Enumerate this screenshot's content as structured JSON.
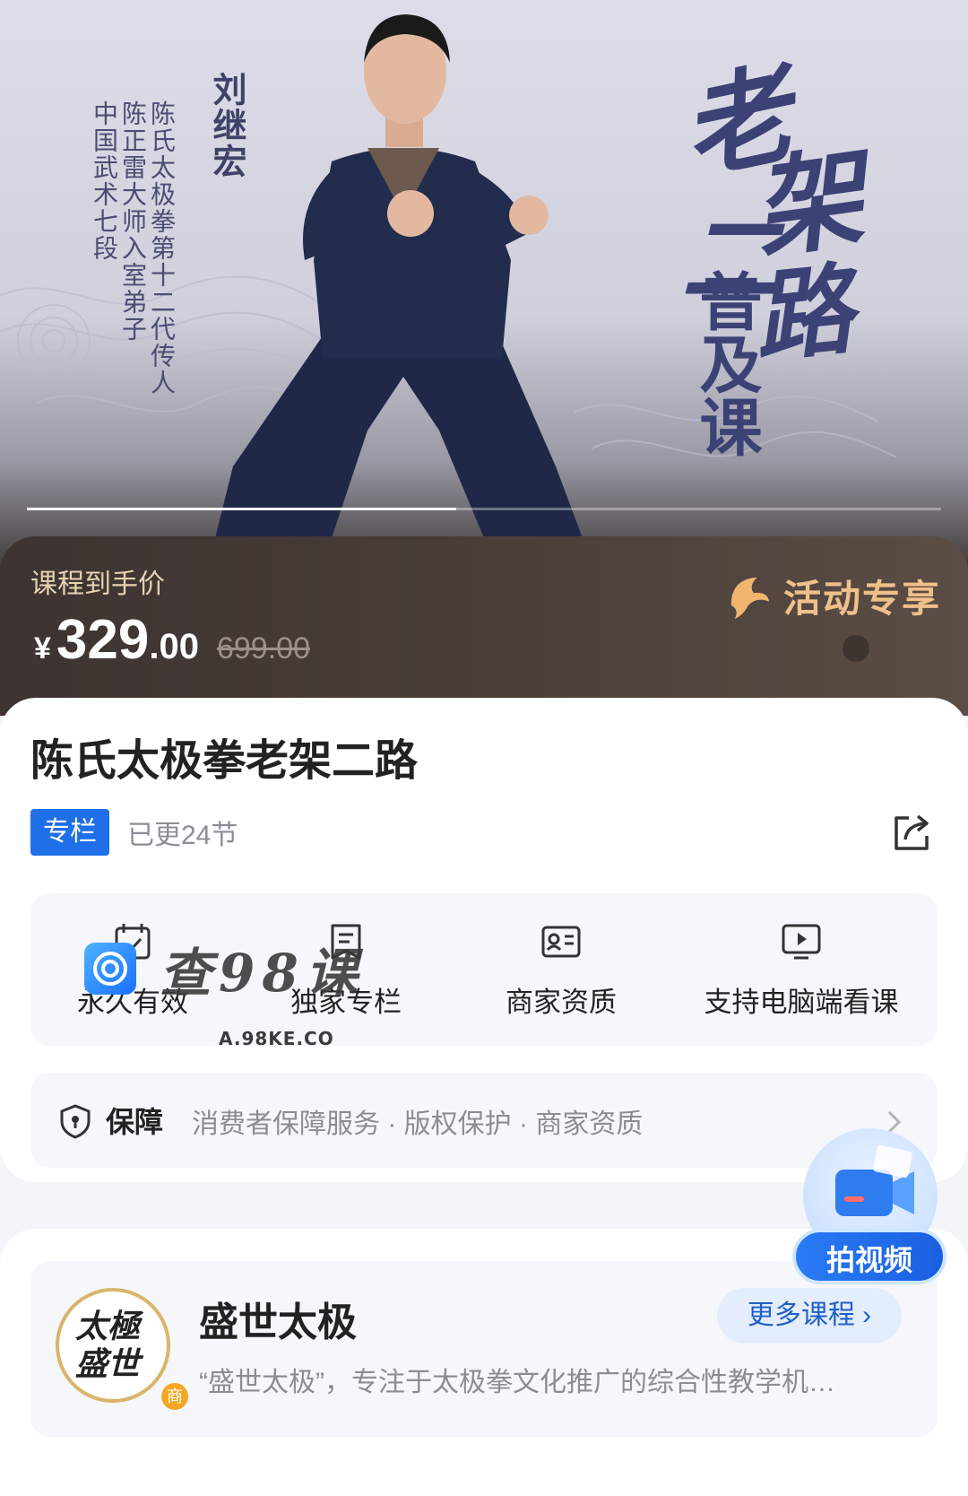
{
  "hero": {
    "teacher_name": "刘继宏",
    "teacher_titles": [
      "陈氏太极拳第十二代传人",
      "陈正雷大师入室弟子",
      "中国武术七段"
    ],
    "poster_title": [
      "老",
      "架",
      "二",
      "路"
    ],
    "poster_subtitle": "普及课",
    "carousel_progress": 0.47
  },
  "price": {
    "caption": "课程到手价",
    "currency": "¥",
    "integer": "329",
    "decimal": ".00",
    "original": "699.00",
    "promo_label": "活动专享"
  },
  "course": {
    "title": "陈氏太极拳老架二路",
    "badge": "专栏",
    "update_status": "已更24节"
  },
  "features": [
    {
      "label": "永久有效",
      "icon": "calendar-check-icon"
    },
    {
      "label": "独家专栏",
      "icon": "bookmark-list-icon"
    },
    {
      "label": "商家资质",
      "icon": "id-card-icon"
    },
    {
      "label": "支持电脑端看课",
      "icon": "monitor-play-icon"
    }
  ],
  "watermark": {
    "text": "查98课",
    "url": "A.98KE.CO"
  },
  "guarantee": {
    "title": "保障",
    "items": "消费者保障服务 · 版权保护 · 商家资质"
  },
  "floating": {
    "label": "拍视频"
  },
  "shop": {
    "logo_text": "太極盛世",
    "logo_badge": "商",
    "name": "盛世太极",
    "more_label": "更多课程",
    "description": "“盛世太极”，专注于太极拳文化推广的综合性教学机…"
  },
  "colors": {
    "accent_blue": "#1e6fe8",
    "promo_gold": "#f0c08a",
    "price_band": "#3d3431"
  }
}
